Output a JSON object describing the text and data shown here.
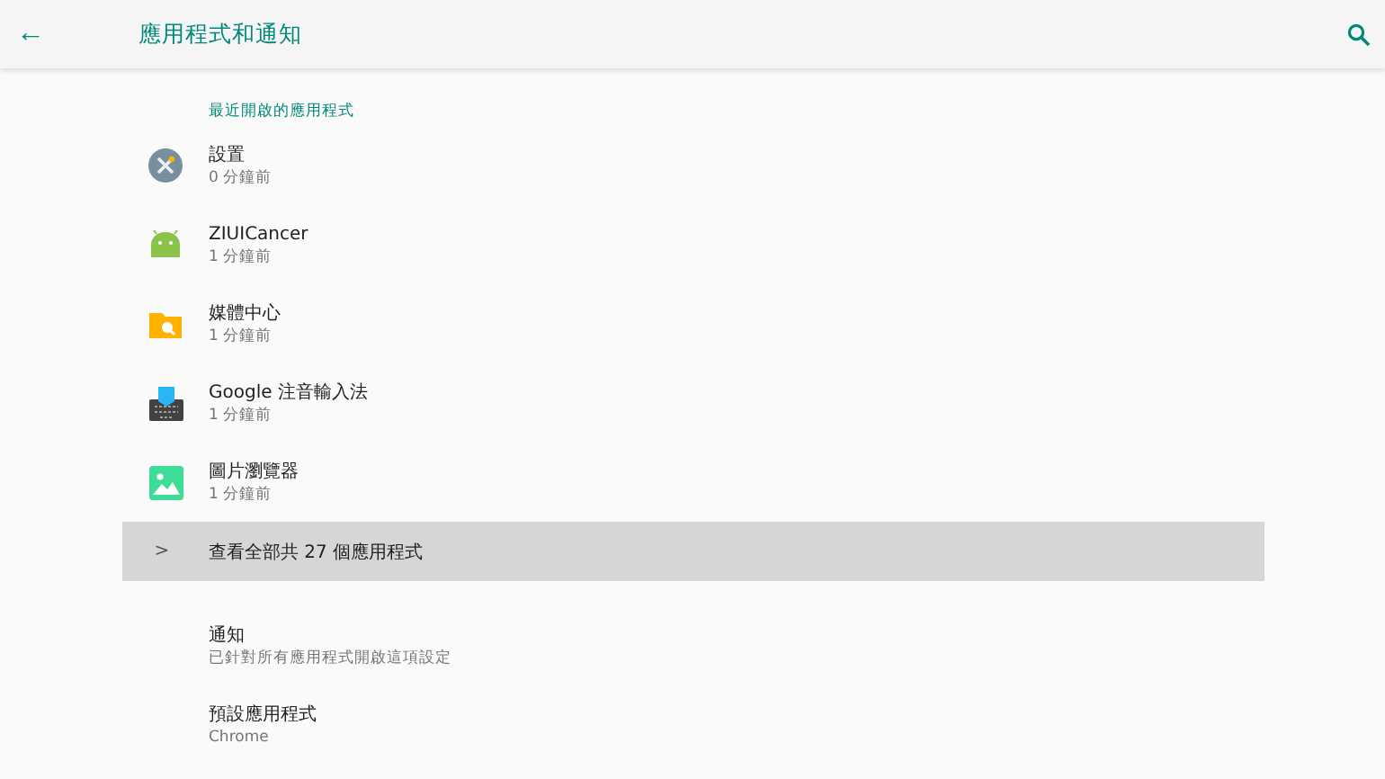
{
  "app_bar": {
    "back": "←",
    "title": "應用程式和通知"
  },
  "recent": {
    "header": "最近開啟的應用程式",
    "apps": [
      {
        "kind": "settings",
        "name": "設置",
        "time": "0 分鐘前"
      },
      {
        "kind": "android",
        "name": "ZIUICancer",
        "time": "1 分鐘前"
      },
      {
        "kind": "folder",
        "name": "媒體中心",
        "time": "1 分鐘前"
      },
      {
        "kind": "keyboard",
        "name": "Google 注音輸入法",
        "time": "1 分鐘前"
      },
      {
        "kind": "gallery",
        "name": "圖片瀏覽器",
        "time": "1 分鐘前"
      }
    ]
  },
  "see_all": {
    "chevron": ">",
    "label": "查看全部共 27 個應用程式",
    "highlighted": true
  },
  "settings": [
    {
      "title": "通知",
      "summary": "已針對所有應用程式開啟這項設定"
    },
    {
      "title": "預設應用程式",
      "summary": "Chrome"
    }
  ]
}
